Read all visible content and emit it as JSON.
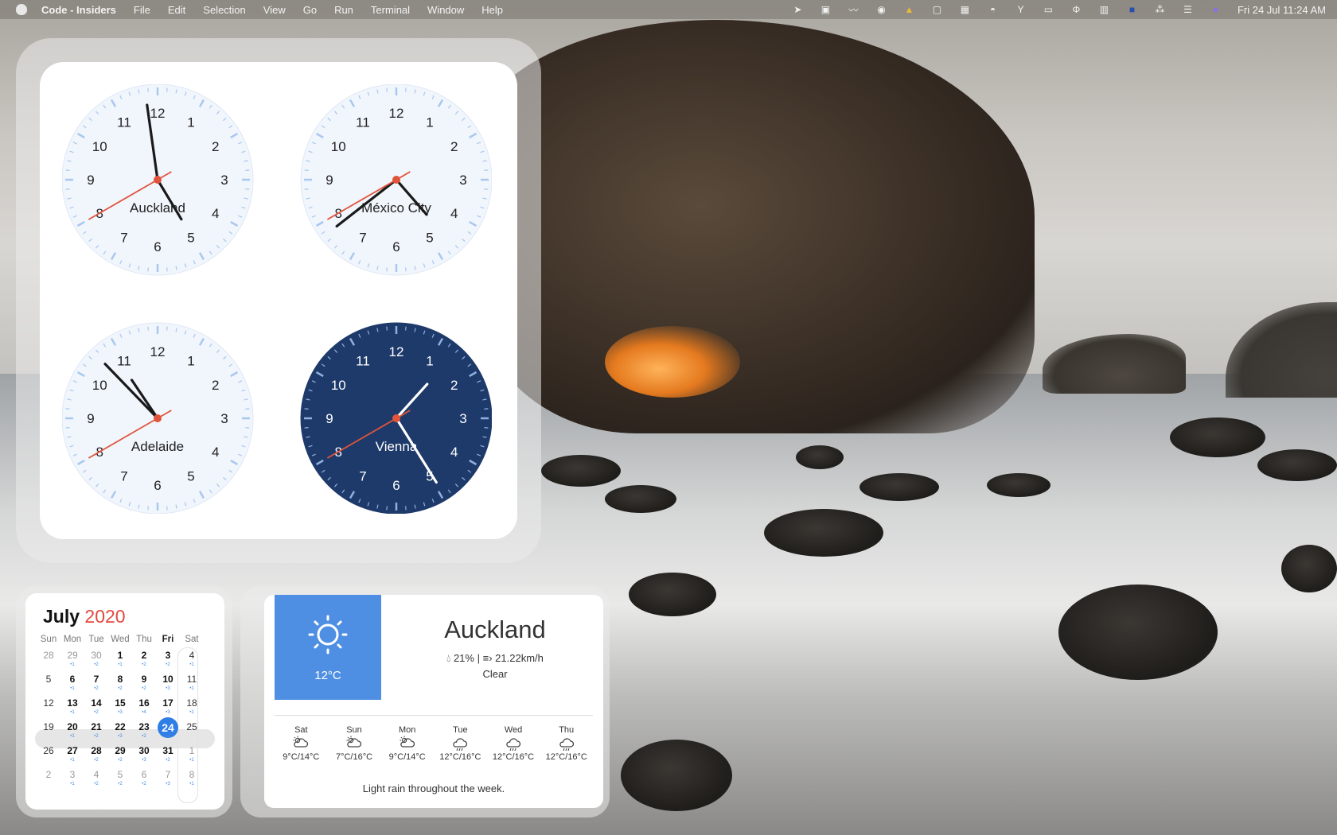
{
  "menubar": {
    "app_name": "Code - Insiders",
    "menus": [
      "File",
      "Edit",
      "Selection",
      "View",
      "Go",
      "Run",
      "Terminal",
      "Window",
      "Help"
    ],
    "datetime": "Fri 24 Jul  11:24 AM"
  },
  "clocks": [
    {
      "city": "Auckland",
      "theme": "light",
      "hour": 4,
      "minute": 58,
      "second": 40
    },
    {
      "city": "México City",
      "theme": "light",
      "hour": 4,
      "minute": 38,
      "second": 40
    },
    {
      "city": "Adelaide",
      "theme": "light",
      "hour": 10,
      "minute": 52,
      "second": 40
    },
    {
      "city": "Vienna",
      "theme": "dark",
      "hour": 1,
      "minute": 24,
      "second": 40
    }
  ],
  "calendar": {
    "month": "July",
    "year": "2020",
    "weekdays": [
      "Sun",
      "Mon",
      "Tue",
      "Wed",
      "Thu",
      "Fri",
      "Sat"
    ],
    "today_weekday": "Fri",
    "today": "24",
    "weeks": [
      [
        {
          "d": "28",
          "s": "dim"
        },
        {
          "d": "29",
          "s": "dim",
          "dots": "•1"
        },
        {
          "d": "30",
          "s": "dim",
          "dots": "•2"
        },
        {
          "d": "1",
          "s": "bold",
          "dots": "•1"
        },
        {
          "d": "2",
          "s": "bold",
          "dots": "•2"
        },
        {
          "d": "3",
          "s": "bold",
          "dots": "•2"
        },
        {
          "d": "4",
          "s": "plain",
          "dots": "•1"
        }
      ],
      [
        {
          "d": "5",
          "s": "plain"
        },
        {
          "d": "6",
          "s": "bold",
          "dots": "•1"
        },
        {
          "d": "7",
          "s": "bold",
          "dots": "•2"
        },
        {
          "d": "8",
          "s": "bold",
          "dots": "•2"
        },
        {
          "d": "9",
          "s": "bold",
          "dots": "•2"
        },
        {
          "d": "10",
          "s": "bold",
          "dots": "•3"
        },
        {
          "d": "11",
          "s": "plain",
          "dots": "•1"
        }
      ],
      [
        {
          "d": "12",
          "s": "plain"
        },
        {
          "d": "13",
          "s": "bold",
          "dots": "•1"
        },
        {
          "d": "14",
          "s": "bold",
          "dots": "•2"
        },
        {
          "d": "15",
          "s": "bold",
          "dots": "•3"
        },
        {
          "d": "16",
          "s": "bold",
          "dots": "•4"
        },
        {
          "d": "17",
          "s": "bold",
          "dots": "•3"
        },
        {
          "d": "18",
          "s": "plain",
          "dots": "•1"
        }
      ],
      [
        {
          "d": "19",
          "s": "plain"
        },
        {
          "d": "20",
          "s": "bold",
          "dots": "•1"
        },
        {
          "d": "21",
          "s": "bold",
          "dots": "•2"
        },
        {
          "d": "22",
          "s": "bold",
          "dots": "•3"
        },
        {
          "d": "23",
          "s": "bold",
          "dots": "•2"
        },
        {
          "d": "24",
          "s": "today",
          "dots": "○1"
        },
        {
          "d": "25",
          "s": "plain"
        }
      ],
      [
        {
          "d": "26",
          "s": "plain"
        },
        {
          "d": "27",
          "s": "bold",
          "dots": "•1"
        },
        {
          "d": "28",
          "s": "bold",
          "dots": "•2"
        },
        {
          "d": "29",
          "s": "bold",
          "dots": "•2"
        },
        {
          "d": "30",
          "s": "bold",
          "dots": "•3"
        },
        {
          "d": "31",
          "s": "bold",
          "dots": "•2"
        },
        {
          "d": "1",
          "s": "dim",
          "dots": "•1"
        }
      ],
      [
        {
          "d": "2",
          "s": "dim"
        },
        {
          "d": "3",
          "s": "dim",
          "dots": "•1"
        },
        {
          "d": "4",
          "s": "dim",
          "dots": "•2"
        },
        {
          "d": "5",
          "s": "dim",
          "dots": "•2"
        },
        {
          "d": "6",
          "s": "dim",
          "dots": "•2"
        },
        {
          "d": "7",
          "s": "dim",
          "dots": "•3"
        },
        {
          "d": "8",
          "s": "dim",
          "dots": "•1"
        }
      ]
    ]
  },
  "weather": {
    "city": "Auckland",
    "current_temp": "12°C",
    "humidity": "21%",
    "wind": "21.22km/h",
    "condition": "Clear",
    "current_icon": "sun-icon",
    "forecast": [
      {
        "day": "Sat",
        "icon": "partly-cloudy-icon",
        "temp": "9°C/14°C"
      },
      {
        "day": "Sun",
        "icon": "partly-cloudy-icon",
        "temp": "7°C/16°C"
      },
      {
        "day": "Mon",
        "icon": "partly-cloudy-icon",
        "temp": "9°C/14°C"
      },
      {
        "day": "Tue",
        "icon": "rain-icon",
        "temp": "12°C/16°C"
      },
      {
        "day": "Wed",
        "icon": "rain-icon",
        "temp": "12°C/16°C"
      },
      {
        "day": "Thu",
        "icon": "rain-icon",
        "temp": "12°C/16°C"
      }
    ],
    "summary": "Light rain throughout the week."
  },
  "colors": {
    "clock_light_face": "#f1f5fc",
    "clock_dark_face": "#1e3a6a",
    "second_hand": "#e0543b",
    "calendar_accent": "#2f7ee6",
    "year_red": "#e2483d",
    "weather_tile": "#4f8fe3"
  }
}
